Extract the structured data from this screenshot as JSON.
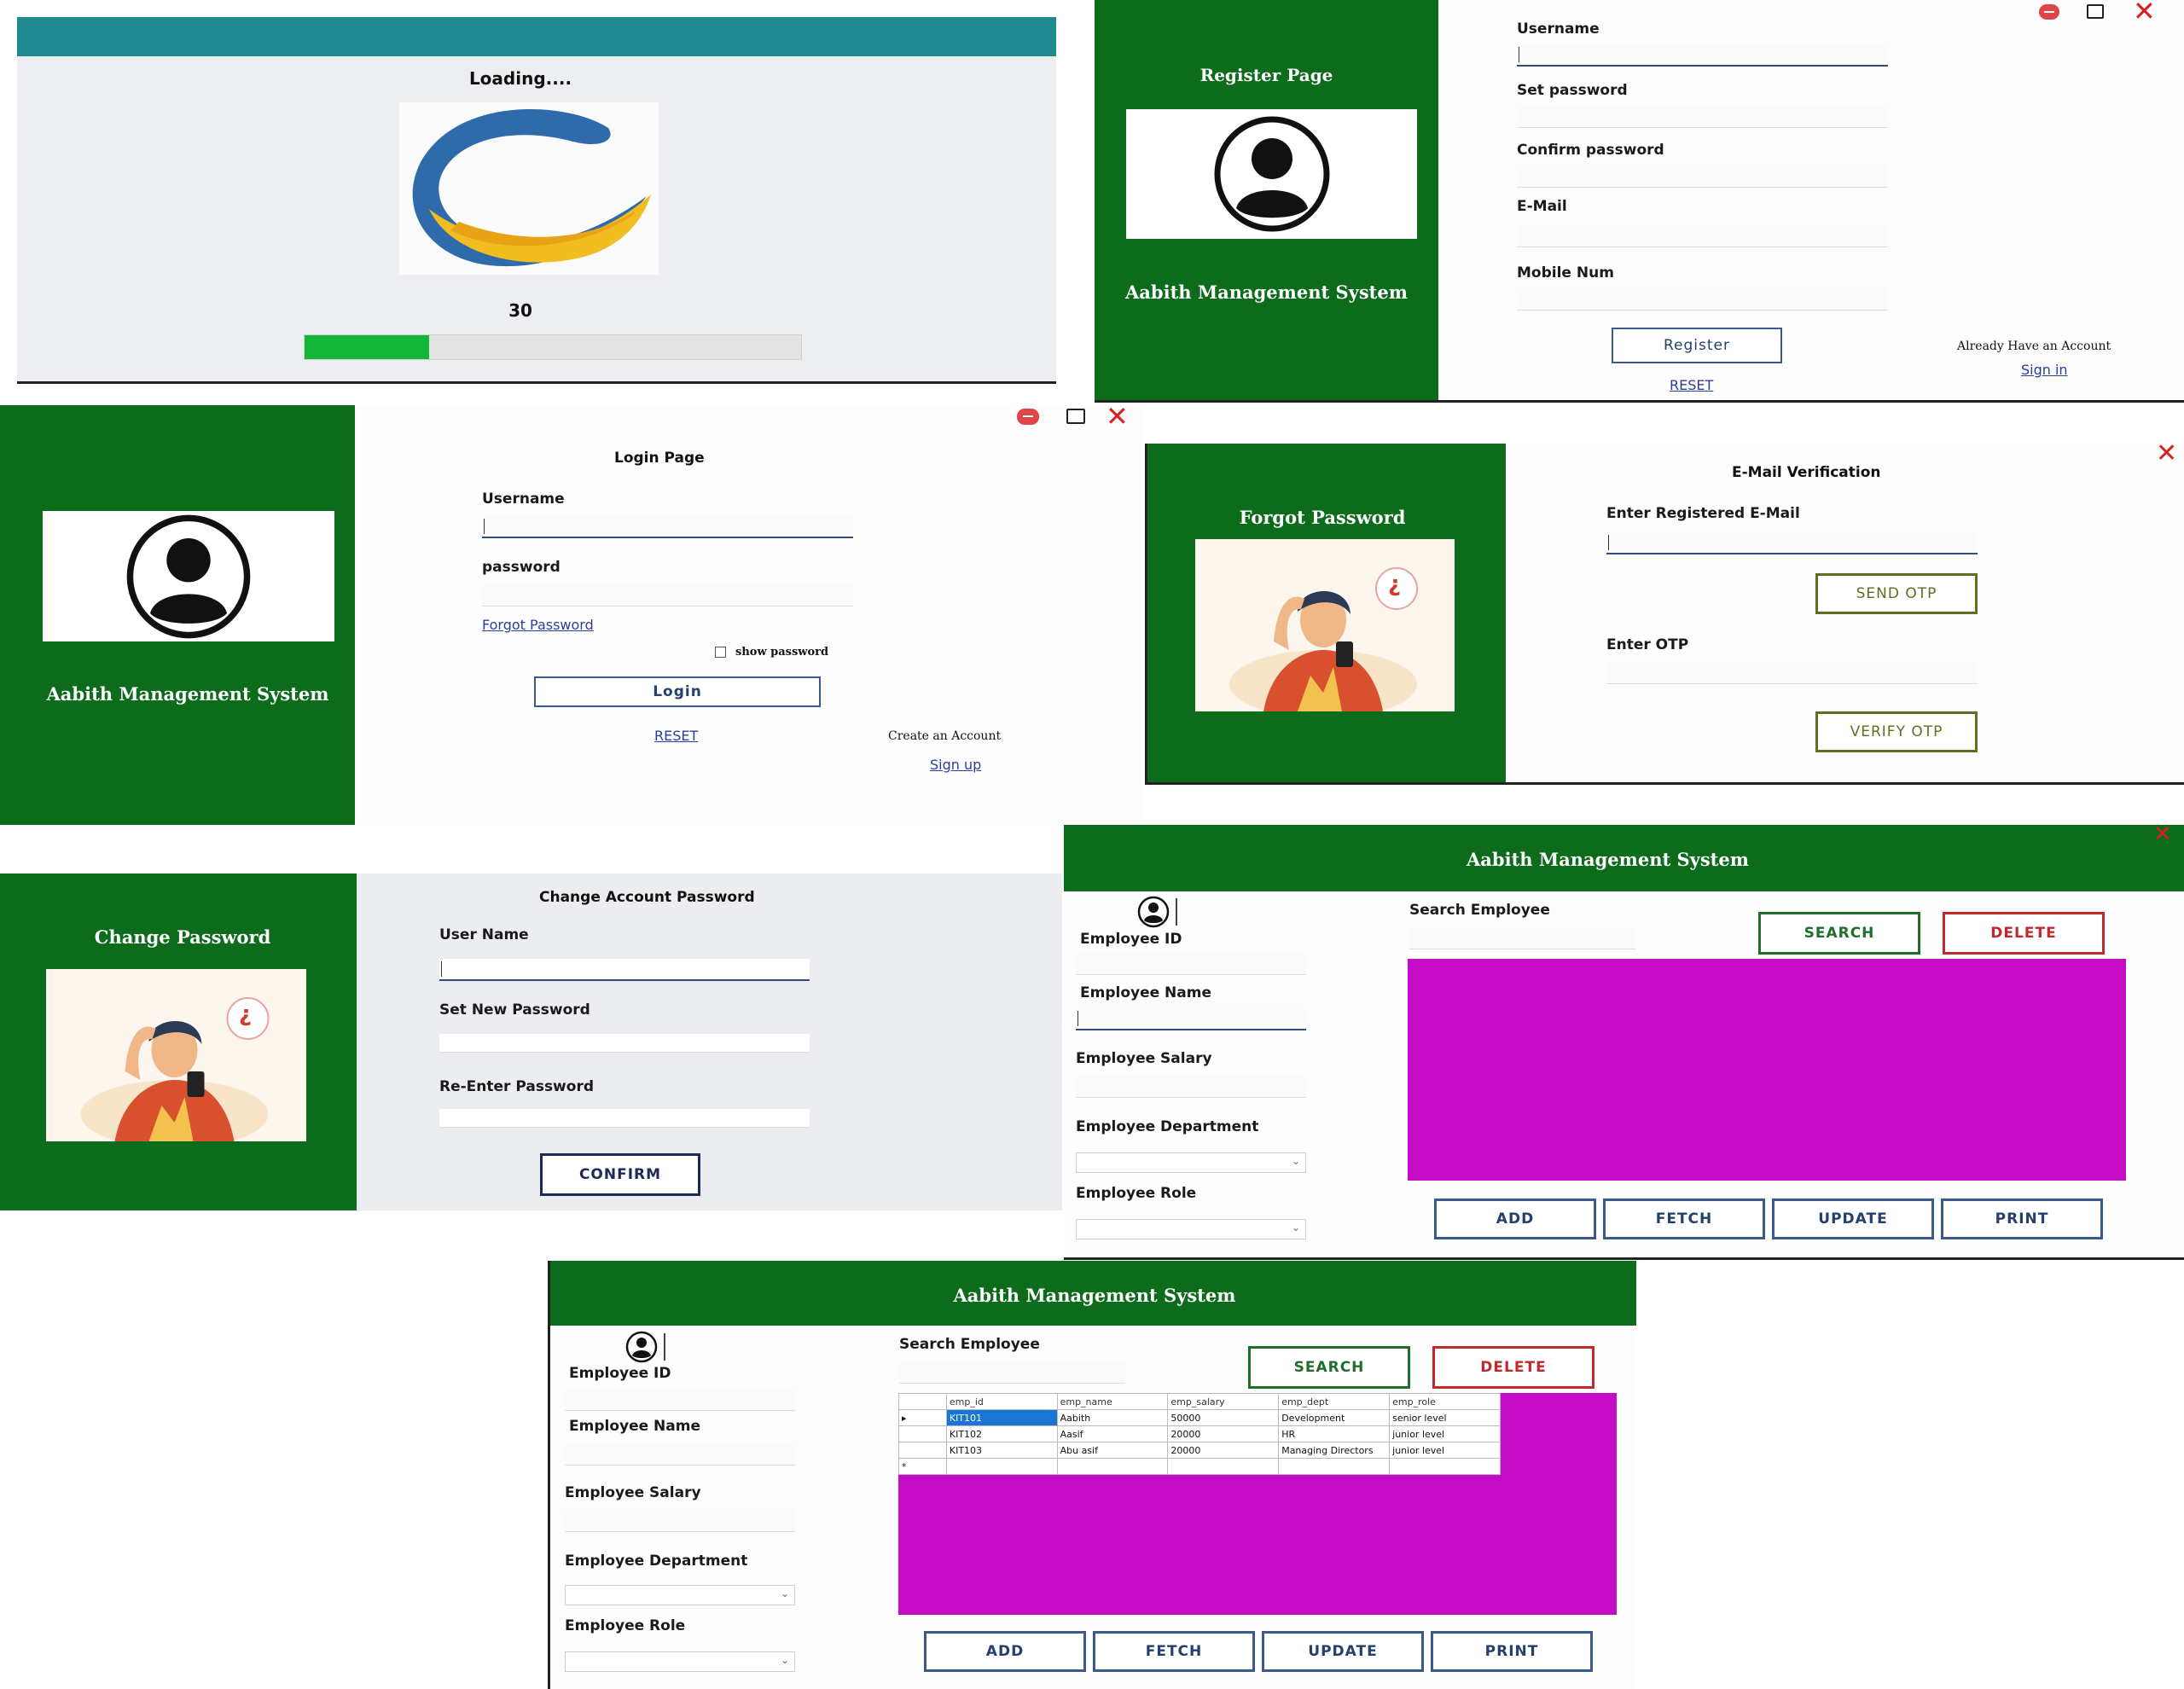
{
  "colors": {
    "green": "#0d6b1c",
    "teal": "#1f8a8f",
    "magenta": "#c40cc4",
    "progress": "#14b63a"
  },
  "loading": {
    "title": "Loading....",
    "value_text": "30",
    "progress_fraction": 0.25
  },
  "register": {
    "side_title": "Register Page",
    "system_name": "Aabith Management System",
    "labels": {
      "username": "Username",
      "set_password": "Set password",
      "confirm_password": "Confirm password",
      "email": "E-Mail",
      "mobile": "Mobile Num"
    },
    "register_button": "Register",
    "reset_link": "RESET",
    "have_account": "Already Have an Account",
    "signin_link": "Sign in"
  },
  "login": {
    "title": "Login Page",
    "system_name": "Aabith Management System",
    "labels": {
      "username": "Username",
      "password": "password"
    },
    "forgot_link": "Forgot Password",
    "show_password": "show password",
    "login_button": "Login",
    "reset_link": "RESET",
    "create_account": "Create an Account",
    "signup_link": "Sign up"
  },
  "forgot": {
    "side_title": "Forgot Password",
    "title": "E-Mail Verification",
    "email_label": "Enter Registered E-Mail",
    "send_otp": "SEND OTP",
    "otp_label": "Enter OTP",
    "verify_otp": "VERIFY OTP",
    "badge": "¿"
  },
  "change": {
    "side_title": "Change Password",
    "title": "Change Account Password",
    "labels": {
      "username": "User Name",
      "new_password": "Set New Password",
      "reenter": "Re-Enter Password"
    },
    "confirm_button": "CONFIRM",
    "badge": "¿"
  },
  "mgmt": {
    "title": "Aabith Management System",
    "labels": {
      "id": "Employee ID",
      "name": "Employee Name",
      "salary": "Employee Salary",
      "dept": "Employee Department",
      "role": "Employee Role",
      "search": "Search Employee"
    },
    "buttons": {
      "search": "SEARCH",
      "delete": "DELETE",
      "add": "ADD",
      "fetch": "FETCH",
      "update": "UPDATE",
      "print": "PRINT"
    }
  },
  "grid": {
    "columns": [
      "emp_id",
      "emp_name",
      "emp_salary",
      "emp_dept",
      "emp_role"
    ],
    "rows": [
      [
        "KIT101",
        "Aabith",
        "50000",
        "Development",
        "senior level"
      ],
      [
        "KIT102",
        "Aasif",
        "20000",
        "HR",
        "junior level"
      ],
      [
        "KIT103",
        "Abu asif",
        "20000",
        "Managing Directors",
        "junior level"
      ]
    ],
    "row_marker": "▸",
    "new_marker": "*"
  }
}
